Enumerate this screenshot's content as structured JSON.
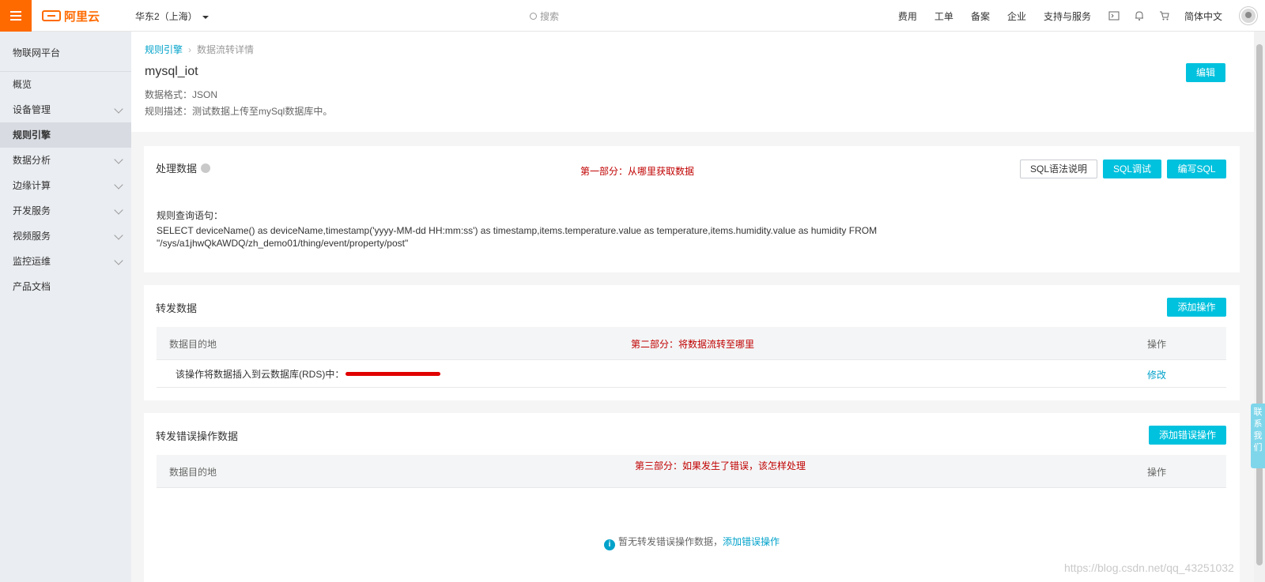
{
  "topbar": {
    "logo_text": "阿里云",
    "region": "华东2（上海）",
    "search_placeholder": "搜索",
    "links": [
      "费用",
      "工单",
      "备案",
      "企业",
      "支持与服务"
    ],
    "language": "简体中文"
  },
  "sidebar": {
    "title": "物联网平台",
    "items": [
      {
        "label": "概览",
        "has_children": false
      },
      {
        "label": "设备管理",
        "has_children": true
      },
      {
        "label": "规则引擎",
        "has_children": false,
        "active": true
      },
      {
        "label": "数据分析",
        "has_children": true
      },
      {
        "label": "边缘计算",
        "has_children": true
      },
      {
        "label": "开发服务",
        "has_children": true
      },
      {
        "label": "视频服务",
        "has_children": true
      },
      {
        "label": "监控运维",
        "has_children": true
      },
      {
        "label": "产品文档",
        "has_children": false
      }
    ]
  },
  "header": {
    "breadcrumb": [
      "规则引擎",
      "数据流转详情"
    ],
    "title": "mysql_iot",
    "data_format": "数据格式：JSON",
    "description": "规则描述：测试数据上传至mySql数据库中。",
    "edit_label": "编辑"
  },
  "process_data": {
    "title": "处理数据",
    "annotation": "第一部分：从哪里获取数据",
    "sql_help_label": "SQL语法说明",
    "sql_debug_label": "SQL调试",
    "write_sql_label": "编写SQL",
    "query_label": "规则查询语句：",
    "query_line1": "SELECT deviceName() as deviceName,timestamp('yyyy-MM-dd HH:mm:ss') as timestamp,items.temperature.value as temperature,items.humidity.value as humidity FROM",
    "query_line2": "\"/sys/a1jhwQkAWDQ/zh_demo01/thing/event/property/post\""
  },
  "forward_data": {
    "title": "转发数据",
    "add_label": "添加操作",
    "annotation": "第二部分：将数据流转至哪里",
    "col_destination": "数据目的地",
    "col_action": "操作",
    "rows": [
      {
        "destination": "该操作将数据插入到云数据库(RDS)中：",
        "action": "修改"
      }
    ]
  },
  "error_forward": {
    "title": "转发错误操作数据",
    "add_label": "添加错误操作",
    "annotation": "第三部分：如果发生了错误，该怎样处理",
    "col_destination": "数据目的地",
    "col_action": "操作",
    "empty_text": "暂无转发错误操作数据，",
    "empty_link": "添加错误操作"
  },
  "float_contact": "联系我们",
  "watermark": "https://blog.csdn.net/qq_43251032",
  "colors": {
    "accent": "#00c1de",
    "brand": "#ff6a00",
    "link": "#00a2ca",
    "annotation": "#c00000"
  }
}
